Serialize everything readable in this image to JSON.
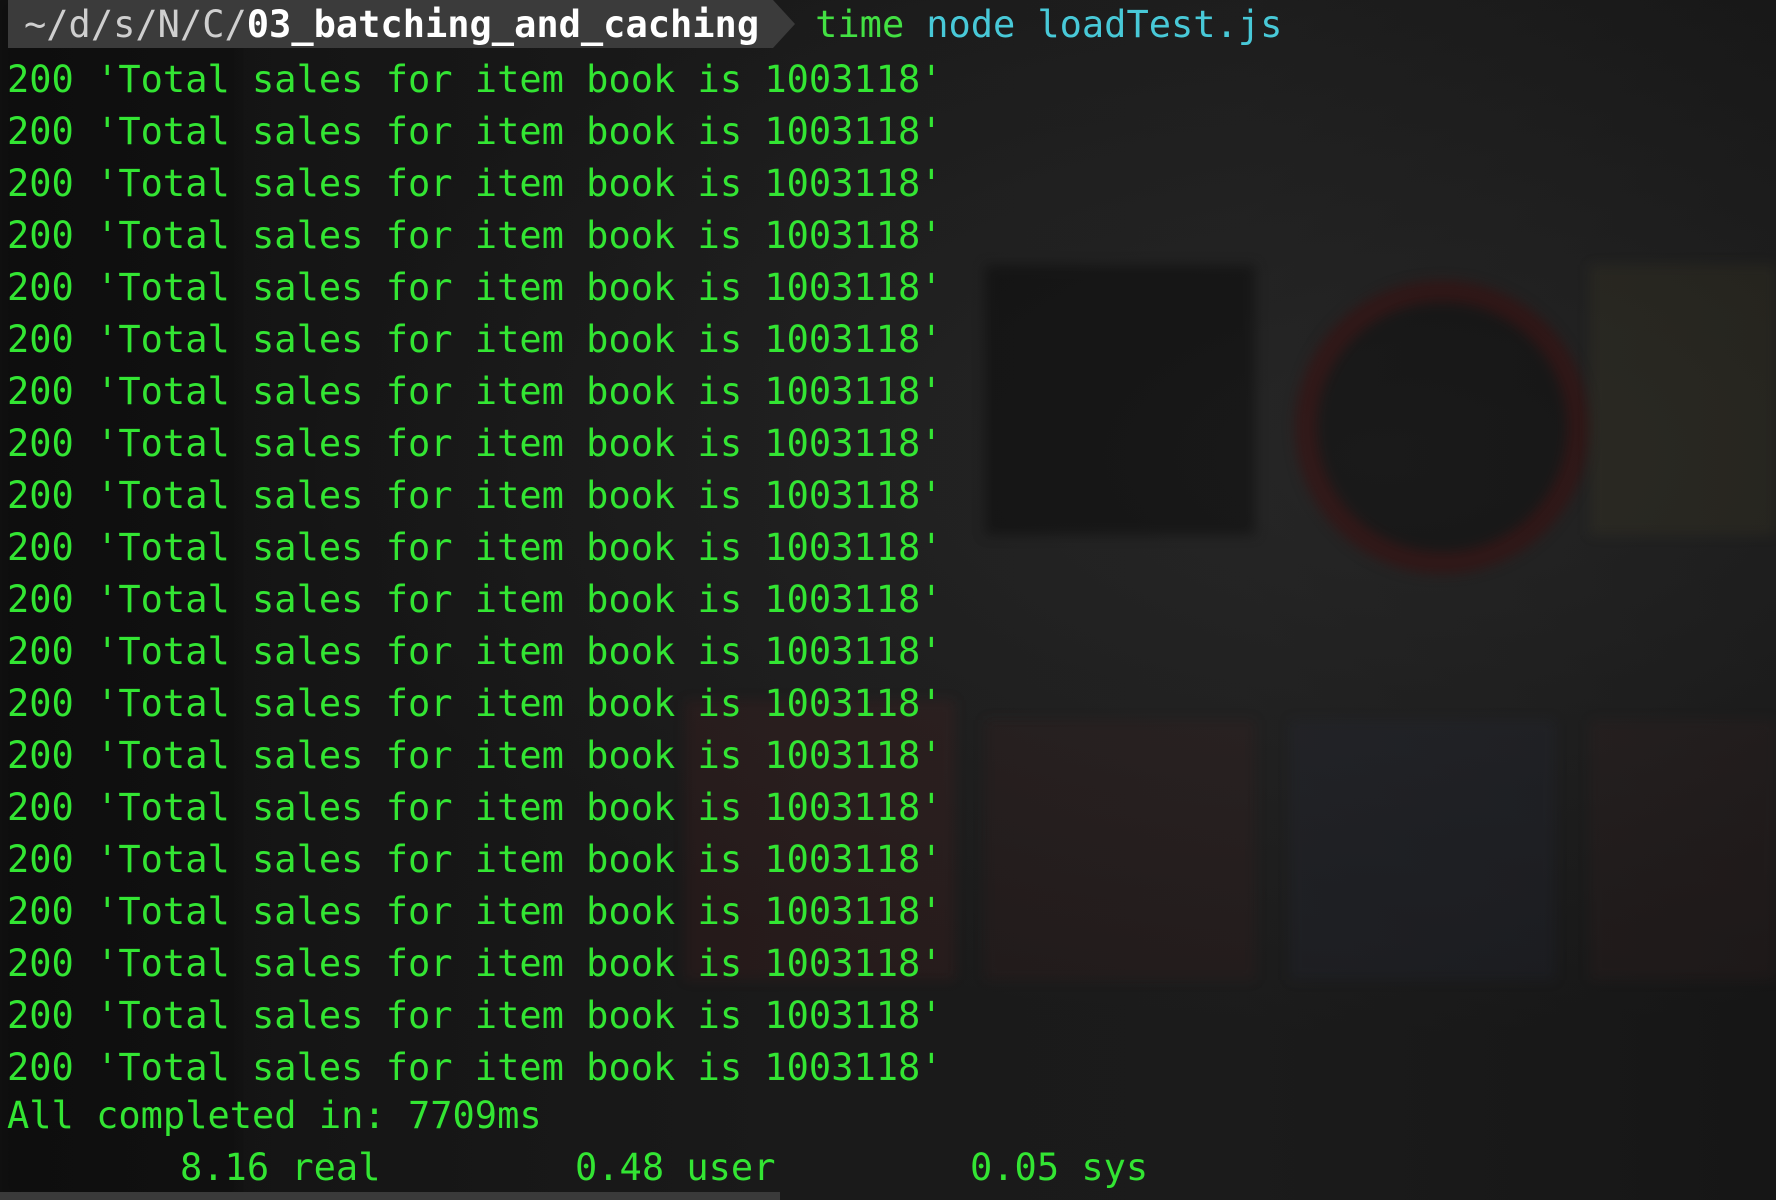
{
  "prompt": {
    "path_prefix": "~/d/s/N/C/",
    "path_current": "03_batching_and_caching",
    "command": "time",
    "program": "node",
    "argument": "loadTest.js"
  },
  "output_lines": [
    "200 'Total sales for item book is 1003118'",
    "200 'Total sales for item book is 1003118'",
    "200 'Total sales for item book is 1003118'",
    "200 'Total sales for item book is 1003118'",
    "200 'Total sales for item book is 1003118'",
    "200 'Total sales for item book is 1003118'",
    "200 'Total sales for item book is 1003118'",
    "200 'Total sales for item book is 1003118'",
    "200 'Total sales for item book is 1003118'",
    "200 'Total sales for item book is 1003118'",
    "200 'Total sales for item book is 1003118'",
    "200 'Total sales for item book is 1003118'",
    "200 'Total sales for item book is 1003118'",
    "200 'Total sales for item book is 1003118'",
    "200 'Total sales for item book is 1003118'",
    "200 'Total sales for item book is 1003118'",
    "200 'Total sales for item book is 1003118'",
    "200 'Total sales for item book is 1003118'",
    "200 'Total sales for item book is 1003118'",
    "200 'Total sales for item book is 1003118'"
  ],
  "summary": "All completed in: 7709ms",
  "timing": {
    "real": "8.16 real",
    "user": "0.48 user",
    "sys": "0.05 sys"
  },
  "colors": {
    "output_green": "#33e533",
    "command_cyan": "#48c9d8",
    "path_segment_bg": "#3b3b3b"
  }
}
